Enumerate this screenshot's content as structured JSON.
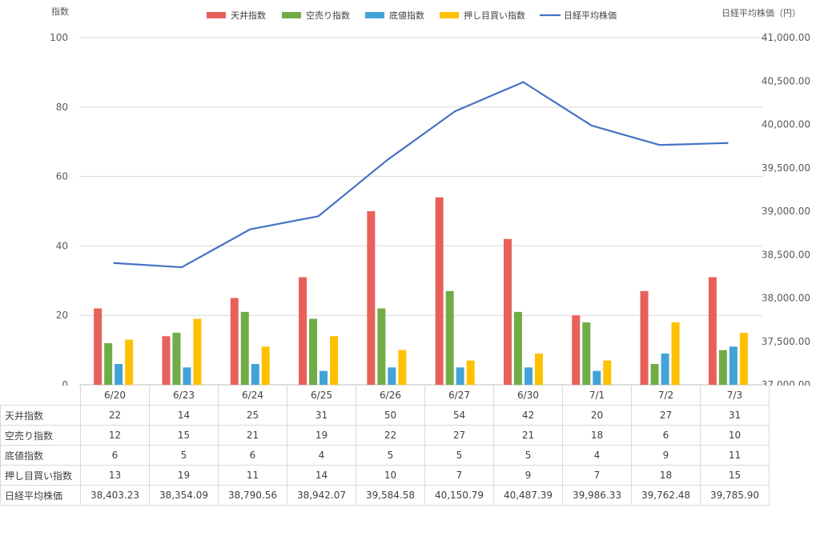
{
  "chart_data": {
    "type": "bar",
    "categories": [
      "6/20",
      "6/23",
      "6/24",
      "6/25",
      "6/26",
      "6/27",
      "6/30",
      "7/1",
      "7/2",
      "7/3"
    ],
    "series": [
      {
        "name": "天井指数",
        "kind": "bar",
        "color": "#e8605a",
        "values": [
          22,
          14,
          25,
          31,
          50,
          54,
          42,
          20,
          27,
          31
        ]
      },
      {
        "name": "空売り指数",
        "kind": "bar",
        "color": "#70ad47",
        "values": [
          12,
          15,
          21,
          19,
          22,
          27,
          21,
          18,
          6,
          10
        ]
      },
      {
        "name": "底値指数",
        "kind": "bar",
        "color": "#43a3d8",
        "values": [
          6,
          5,
          6,
          4,
          5,
          5,
          5,
          4,
          9,
          11
        ]
      },
      {
        "name": "押し目買い指数",
        "kind": "bar",
        "color": "#ffc000",
        "values": [
          13,
          19,
          11,
          14,
          10,
          7,
          9,
          7,
          18,
          15
        ]
      },
      {
        "name": "日経平均株価",
        "kind": "line",
        "axis": "right",
        "color": "#4472c4",
        "values": [
          38403.23,
          38354.09,
          38790.56,
          38942.07,
          39584.58,
          40150.79,
          40487.39,
          39986.33,
          39762.48,
          39785.9
        ]
      }
    ],
    "ylabel": "指数",
    "y2label": "日経平均株価（円）",
    "ylim": [
      0,
      100
    ],
    "yticks": [
      "0",
      "20",
      "40",
      "60",
      "80",
      "100"
    ],
    "y2lim": [
      37000,
      41000
    ],
    "y2ticks": [
      "37,000.00",
      "37,500.00",
      "38,000.00",
      "38,500.00",
      "39,000.00",
      "39,500.00",
      "40,000.00",
      "40,500.00",
      "41,000.00"
    ],
    "grid": true,
    "legend": "top",
    "table": {
      "rows": [
        {
          "label": "天井指数",
          "color": "#e8605a",
          "cells": [
            "22",
            "14",
            "25",
            "31",
            "50",
            "54",
            "42",
            "20",
            "27",
            "31"
          ]
        },
        {
          "label": "空売り指数",
          "color": "#70ad47",
          "cells": [
            "12",
            "15",
            "21",
            "19",
            "22",
            "27",
            "21",
            "18",
            "6",
            "10"
          ]
        },
        {
          "label": "底値指数",
          "color": "#43a3d8",
          "cells": [
            "6",
            "5",
            "6",
            "4",
            "5",
            "5",
            "5",
            "4",
            "9",
            "11"
          ]
        },
        {
          "label": "押し目買い指数",
          "color": "#ffc000",
          "cells": [
            "13",
            "19",
            "11",
            "14",
            "10",
            "7",
            "9",
            "7",
            "18",
            "15"
          ]
        },
        {
          "label": "日経平均株価",
          "color": "#4472c4",
          "cells": [
            "38,403.23",
            "38,354.09",
            "38,790.56",
            "38,942.07",
            "39,584.58",
            "40,150.79",
            "40,487.39",
            "39,986.33",
            "39,762.48",
            "39,785.90"
          ]
        }
      ]
    }
  }
}
